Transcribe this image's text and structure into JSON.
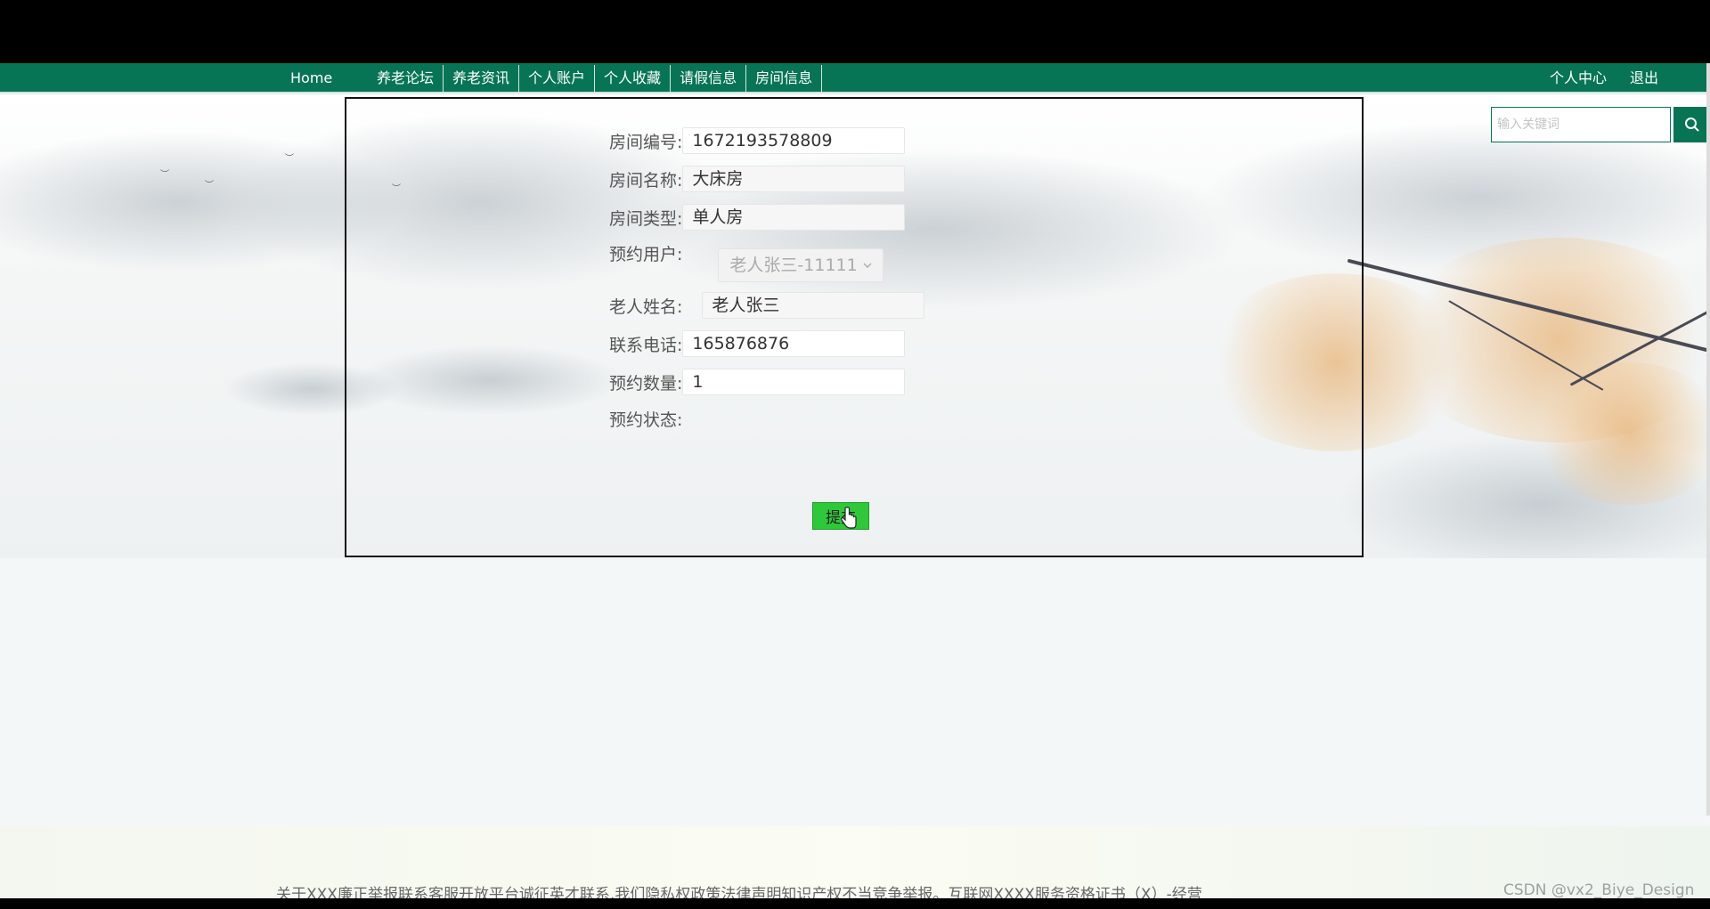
{
  "nav": {
    "home": "Home",
    "menu": [
      "养老论坛",
      "养老资讯",
      "个人账户",
      "个人收藏",
      "请假信息",
      "房间信息"
    ],
    "personal_center": "个人中心",
    "logout": "退出"
  },
  "search": {
    "placeholder": "输入关键词",
    "icon": "search-icon"
  },
  "form": {
    "room_no": {
      "label": "房间编号:",
      "value": "1672193578809"
    },
    "room_name": {
      "label": "房间名称:",
      "value": "大床房"
    },
    "room_type": {
      "label": "房间类型:",
      "value": "单人房"
    },
    "booking_user": {
      "label": "预约用户:",
      "value": "老人张三-11111"
    },
    "elder_name": {
      "label": "老人姓名:",
      "value": "老人张三"
    },
    "phone": {
      "label": "联系电话:",
      "value": "165876876"
    },
    "quantity": {
      "label": "预约数量:",
      "value": "1"
    },
    "status": {
      "label": "预约状态:"
    },
    "submit": "提交"
  },
  "footer": {
    "text": "关于XXX廉正举报联系客服开放平台诚征英才联系,我们隐私权政策法律声明知识产权不当竞争举报。互联网XXXX服务资格证书（X）-经营",
    "watermark": "CSDN @vx2_Biye_Design"
  },
  "colors": {
    "nav": "#067455",
    "submit": "#2fc83a"
  }
}
